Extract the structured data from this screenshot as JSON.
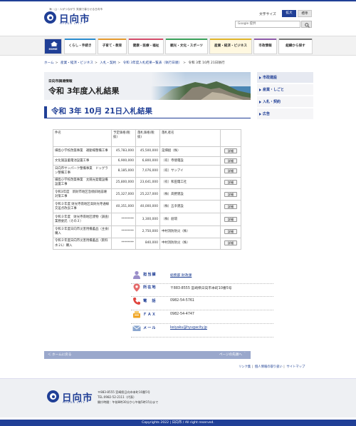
{
  "header": {
    "tagline": "海・山・人がつながり 笑顔で暮らせる日向市",
    "logo_name": "日向市",
    "logo_en": "HYUGA CITY",
    "font_size_label": "文字サイズ",
    "font_size_large": "拡大",
    "font_size_standard": "標準",
    "search_placeholder": "Google 提供",
    "search_icon": "search-icon"
  },
  "nav": {
    "home_label": "HOME",
    "items": [
      {
        "label": "くらし・手続き",
        "color": "#2a8ccf"
      },
      {
        "label": "子育て・教育",
        "color": "#e59a2e"
      },
      {
        "label": "健康・医療・福祉",
        "color": "#d44c6a"
      },
      {
        "label": "観光・文化・スポーツ",
        "color": "#3aa15a"
      },
      {
        "label": "産業・経済・ビジネス",
        "color": "#e0b52a"
      },
      {
        "label": "市政情報",
        "color": "#8e5aa8"
      },
      {
        "label": "組織から探す",
        "color": "#777777"
      }
    ]
  },
  "breadcrumb": {
    "items": [
      "ホーム",
      "産業・経済・ビジネス",
      "入札・契約",
      "令和 3年度入札結果一覧表（執行日順）"
    ],
    "current": "令和 3年 10月 21日執行"
  },
  "banner": {
    "subtitle": "日向市調達情報",
    "title": "令和 3年度入札結果"
  },
  "page_title": "令和 3年 10月 21日入札結果",
  "sidebar": {
    "items": [
      {
        "label": "市政建設"
      },
      {
        "label": "産業・しごと"
      },
      {
        "label": "入札・契約"
      },
      {
        "label": "広告"
      }
    ]
  },
  "table": {
    "headers": [
      "件名",
      "予定価格(税抜)",
      "落札価格(税抜)",
      "落札者名",
      ""
    ],
    "detail_label": "詳細",
    "rows": [
      {
        "name": "細島小学校改築事業　運動場整備工事",
        "planned": "45,783,000",
        "winning": "45,500,000",
        "winner": "菜畑組（株）"
      },
      {
        "name": "文化施設蓄電池設置工事",
        "planned": "6,900,000",
        "winning": "6,800,000",
        "winner": "（有）寺徳電設"
      },
      {
        "name": "日向市サンパーク整備事業　ドッグラン整備工事",
        "planned": "8,185,000",
        "winning": "7,076,000",
        "winner": "（有）サンアイ"
      },
      {
        "name": "細島小学校改築事業　太陽光発電設備設置工事",
        "planned": "25,800,000",
        "winning": "23,641,000",
        "winner": "（有）和田電工社"
      },
      {
        "name": "令和3年度　新財市地区急傾斜地崩壊対策工事",
        "planned": "25,327,000",
        "winning": "25,227,000",
        "winner": "（株）髙野建設"
      },
      {
        "name": "令和３年度 財光寺南地区高財光寺通線交差点改良工事",
        "planned": "40,351,000",
        "winning": "40,000,000",
        "winner": "（株）五幸建設"
      },
      {
        "name": "令和３年度　財光寺南地区建物（調査）業務委託（その３）",
        "planned": "********",
        "winning": "3,300,000",
        "winner": "（株）創環"
      },
      {
        "name": "令和３年度日向市災害用備蓄品（主食）購入",
        "planned": "********",
        "winning": "2,750,000",
        "winner": "中村消防防災（株）"
      },
      {
        "name": "令和３年度日向市災害用備蓄品（飲料水２L）購入",
        "planned": "********",
        "winning": "840,000",
        "winner": "中村消防防災（株）"
      }
    ]
  },
  "contact": {
    "department_label": "担当課",
    "department_value": "総務部 財政課",
    "address_label": "所在地",
    "address_value": "〒883-8555 宮崎県日向市本町10番5号",
    "phone_label": "電　話",
    "phone_value": "0982-54-5761",
    "fax_label": "ＦＡＸ",
    "fax_value": "0982-54-4747",
    "mail_label": "メール",
    "mail_value": "keiyaku@hyugacity.jp"
  },
  "pagebar": {
    "back": "＜ ホームに戻る",
    "top": "ページの先頭へ ＾"
  },
  "footer_links": [
    "リンク集",
    "個人情報の取り扱い",
    "サイトマップ"
  ],
  "footer": {
    "logo_name": "日向市",
    "logo_en": "HYUGA CITY",
    "address": "〒883-8555 宮崎県日向市本町10番5号",
    "tel": "TEL:0982-52-2111（代表）",
    "hours": "開庁時間：午前8時30分から午後5時15分まで"
  },
  "copyright": "Copyrights 2022 | 日向市 / All right reserved.",
  "colors": {
    "brand": "#203f96",
    "link": "#1d3f93"
  }
}
